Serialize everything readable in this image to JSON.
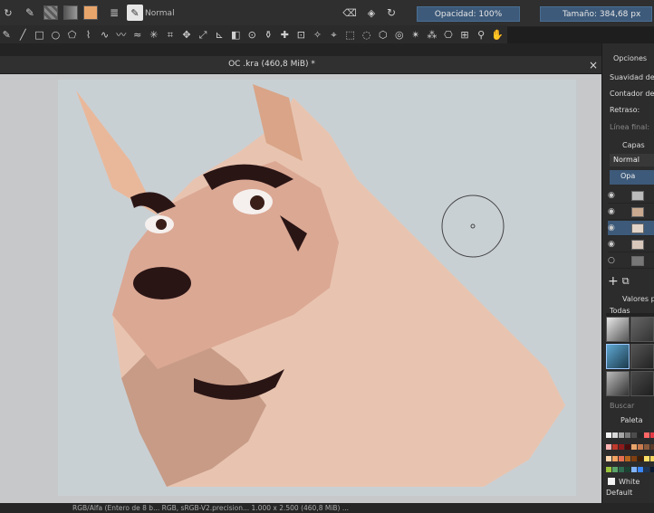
{
  "topbar": {
    "blend_mode": "Normal",
    "opacity_label": "Opacidad: 100%",
    "size_label": "Tamaño: 384,68 px",
    "fg_color": "#e8a56b",
    "bg_color": "#f2f2f2"
  },
  "tools": [
    "freehand-brush",
    "line",
    "rectangle",
    "ellipse",
    "polygon",
    "polyline",
    "bezier",
    "freehand-path",
    "dynamic-brush",
    "multibrush",
    "crop",
    "move",
    "transform",
    "measure",
    "gradient",
    "color-picker",
    "fill",
    "smart-patch",
    "enclose-fill",
    "assistant",
    "reference",
    "rect-select",
    "ellipse-select",
    "polygon-select",
    "freehand-select",
    "contiguous-select",
    "similar-select",
    "bezier-select",
    "magnetic-select",
    "zoom",
    "pan"
  ],
  "document": {
    "title": "OC .kra (460,8 MiB) *",
    "close": "×"
  },
  "right_panel": {
    "tool_options": "Opciones",
    "smoothing": "Suavidad del",
    "contour": "Contador de",
    "delay": "Retraso:",
    "final_line": "Línea final:",
    "layers_title": "Capas",
    "layers_blend": "Normal",
    "opacity_btn": "Opa",
    "presets_title": "Valores pre",
    "presets_tag": "Todas",
    "search": "Buscar",
    "palette_title": "Paleta",
    "white_label": "White",
    "default_label": "Default"
  },
  "status": "RGB/Alfa (Entero de 8 b... RGB, sRGB-V2.precision... 1.000 x 2.500 (460,8 MiB)   ...",
  "palette_colors": [
    "#f2f2f2",
    "#d9d9d9",
    "#a6a6a6",
    "#7a7a7a",
    "#4d4d4d",
    "#262626",
    "#ff6666",
    "#e63946",
    "#ffb3b3",
    "#c0392b",
    "#8e1b1b",
    "#4a0d0d",
    "#e8a56b",
    "#c97b4f",
    "#8a5a3c",
    "#5a3a28",
    "#ffd8b0",
    "#f4a261",
    "#e76f51",
    "#b5651d",
    "#7f3f11",
    "#3e1f08",
    "#ffe066",
    "#f4d35e",
    "#9bc53d",
    "#5aa469",
    "#2d6a4f",
    "#1b4332",
    "#81b3ff",
    "#3a86ff",
    "#1d3557",
    "#0b1a33"
  ]
}
